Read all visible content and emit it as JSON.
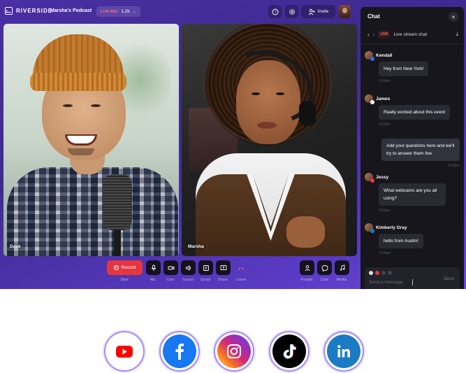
{
  "app": {
    "brand": "RIVERSIDE",
    "podcast_name": "Marsha's Podcast",
    "live_indicator": "LIVE REC",
    "viewer_count": "1.2k",
    "invite_label": "Invite"
  },
  "participants": [
    {
      "name": "Dave"
    },
    {
      "name": "Marsha"
    }
  ],
  "controls": {
    "record_label": "Record",
    "record_caption": "Start",
    "buttons": [
      {
        "label": "Mic"
      },
      {
        "label": "Cam"
      },
      {
        "label": "Sound"
      },
      {
        "label": "Script"
      },
      {
        "label": "Share"
      },
      {
        "label": "Leave"
      }
    ],
    "right_buttons": [
      {
        "label": "People"
      },
      {
        "label": "Chat"
      },
      {
        "label": "Media"
      }
    ]
  },
  "chat": {
    "title": "Chat",
    "live_tag": "LIVE",
    "subtitle": "Live stream chat",
    "messages": [
      {
        "name": "Kendall",
        "text": "Hey from New York!",
        "time": "3:24pm",
        "badge_color": "#2f6fe4"
      },
      {
        "name": "James",
        "text": "Really excited about this event",
        "time": "3:24pm",
        "badge_color": "#ffffff"
      },
      {
        "text": "Add your questions here and we'll try to answer them live",
        "time": "3:24pm",
        "own": true
      },
      {
        "name": "Jessy",
        "text": "What webcams are you all using?",
        "time": "3:24pm",
        "badge_color": "#e5363f"
      },
      {
        "name": "Kimberly Gray",
        "text": "hello from Austin!",
        "time": "3:24pm",
        "badge_color": "#1f7bc1"
      }
    ],
    "input_placeholder": "Send a message",
    "send_label": "Send"
  },
  "socials": [
    {
      "name": "YouTube",
      "color": "#ff0000"
    },
    {
      "name": "Facebook",
      "color": "#1877f2"
    },
    {
      "name": "Instagram",
      "color": "#d62976"
    },
    {
      "name": "TikTok",
      "color": "#000000"
    },
    {
      "name": "LinkedIn",
      "color": "#0a66c2"
    }
  ]
}
